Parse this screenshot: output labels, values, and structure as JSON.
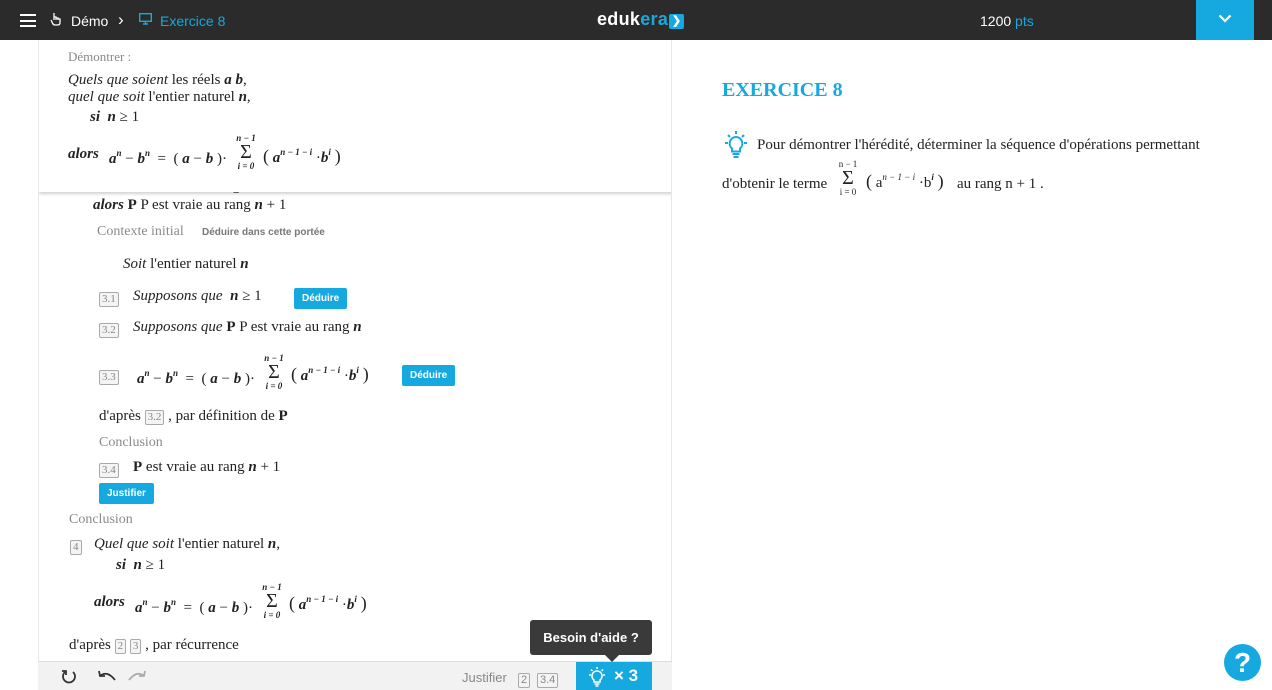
{
  "header": {
    "demo_label": "Démo",
    "separator": "›",
    "exercise_label": "Exercice 8",
    "logo_part1": "eduk",
    "logo_part2": "era",
    "points_value": "1200",
    "points_unit": "pts"
  },
  "sticky": {
    "heading": "Démontrer :",
    "line1_italic": "Quels que soient",
    "line1_rest": " les réels ",
    "line1_vars": "a b",
    "line1_end": ",",
    "line2_italic": "quel que soit",
    "line2_rest": " l'entier naturel ",
    "line2_var": "n",
    "line2_end": ",",
    "line3_si": "si",
    "line3_cond": "n",
    "line3_op": "≥ 1",
    "line4_alors": "alors"
  },
  "proof": {
    "hidden_line": "si P est vraie au rang n",
    "alors_label": "alors",
    "alors_rest": " P est vraie au rang ",
    "alors_expr": "n",
    "alors_plus": " + 1",
    "ctx_label": "Contexte initial",
    "ctx_action": "Déduire dans cette portée",
    "soit_italic": "Soit",
    "soit_rest": " l'entier naturel ",
    "soit_var": "n",
    "s31_num": "3.1",
    "s31_italic": "Supposons que",
    "s31_var": "n",
    "s31_op": "≥ 1",
    "s32_num": "3.2",
    "s32_italic": "Supposons que",
    "s32_rest": " P est vraie au rang ",
    "s32_var": "n",
    "s33_num": "3.3",
    "deduire": "Déduire",
    "dapres_label": "d'après",
    "dapres_ref": "3.2",
    "dapres_rest": ", par définition de ",
    "dapres_P": "P",
    "conclusion_inner": "Conclusion",
    "s34_num": "3.4",
    "s34_rest": " est vraie au rang ",
    "s34_P": "P",
    "s34_var": "n",
    "s34_plus": " + 1",
    "justifier": "Justifier",
    "conclusion_outer": "Conclusion",
    "s4_num": "4",
    "s4_italic": "Quel que soit",
    "s4_rest": " l'entier naturel ",
    "s4_var": "n",
    "s4_end": ",",
    "s4_si": "si",
    "s4_cond": "n",
    "s4_op": "≥ 1",
    "s4_alors": "alors",
    "final_dapres": "d'après",
    "final_ref1": "2",
    "final_ref2": "3",
    "final_rest": ", par récurrence"
  },
  "formula": {
    "a": "a",
    "b": "b",
    "n": "n",
    "minus": "−",
    "eq": "=",
    "sigma": "Σ",
    "upper": "n − 1",
    "lower": "i = 0",
    "exp_a": "n − 1 − i",
    "exp_b": "i",
    "dot": "·"
  },
  "toolbar": {
    "justifier_label": "Justifier",
    "ref1": "2",
    "ref2": "3.4",
    "help_count": "× 3",
    "tooltip": "Besoin d'aide ?"
  },
  "right": {
    "title": "EXERCICE 8",
    "hint_text1": "Pour démontrer l'hérédité, déterminer la séquence d'opérations permettant",
    "hint_text2": "d'obtenir le terme",
    "hint_text3": "au rang n + 1 .",
    "sigma_upper": "n − 1",
    "sigma_lower": "i = 0",
    "help_symbol": "?"
  },
  "colors": {
    "accent": "#16a9df",
    "topbar": "#2b2b2b"
  },
  "icons": [
    "hamburger-icon",
    "hand-pointer-icon",
    "monitor-icon",
    "chevron-down-icon",
    "reset-icon",
    "undo-icon",
    "redo-icon",
    "lightbulb-icon",
    "question-icon"
  ]
}
